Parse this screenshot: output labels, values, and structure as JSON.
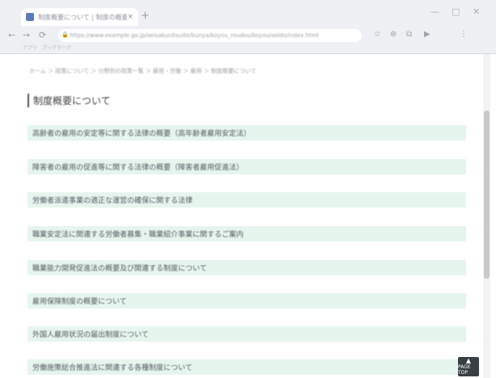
{
  "browser": {
    "tab_title": "制度概要について | 制度の概要 | 厚生労働省",
    "tab_close": "×",
    "new_tab": "+",
    "window_controls": [
      "—",
      "□",
      "✕"
    ],
    "nav": {
      "back": "←",
      "forward": "→",
      "reload": "⟳"
    },
    "address": "https://www.example.go.jp/seisakunitsuite/bunya/koyou_roudou/koyou/seido/index.html",
    "bookmarks": [
      "アプリ",
      "ブックマーク"
    ],
    "toolbar_icons": [
      "☆",
      "⊕",
      "⧉",
      "▶",
      "⋮"
    ]
  },
  "page": {
    "breadcrumb": "ホーム ＞ 政策について ＞ 分野別の政策一覧 ＞ 雇用・労働 ＞ 雇用 ＞ 制度概要について",
    "section_title": "制度概要について",
    "links": [
      "高齢者の雇用の安定等に関する法律の概要（高年齢者雇用安定法）",
      "障害者の雇用の促進等に関する法律の概要（障害者雇用促進法）",
      "労働者派遣事業の適正な運営の確保に関する法律",
      "職業安定法に関連する労働者募集・職業紹介事業に関するご案内",
      "職業能力開発促進法の概要及び関連する制度について",
      "雇用保険制度の概要について",
      "外国人雇用状況の届出制度について",
      "労働施策総合推進法に関連する各種制度について"
    ],
    "page_top_label": "PAGE TOP",
    "page_top_arrow": "▲"
  }
}
